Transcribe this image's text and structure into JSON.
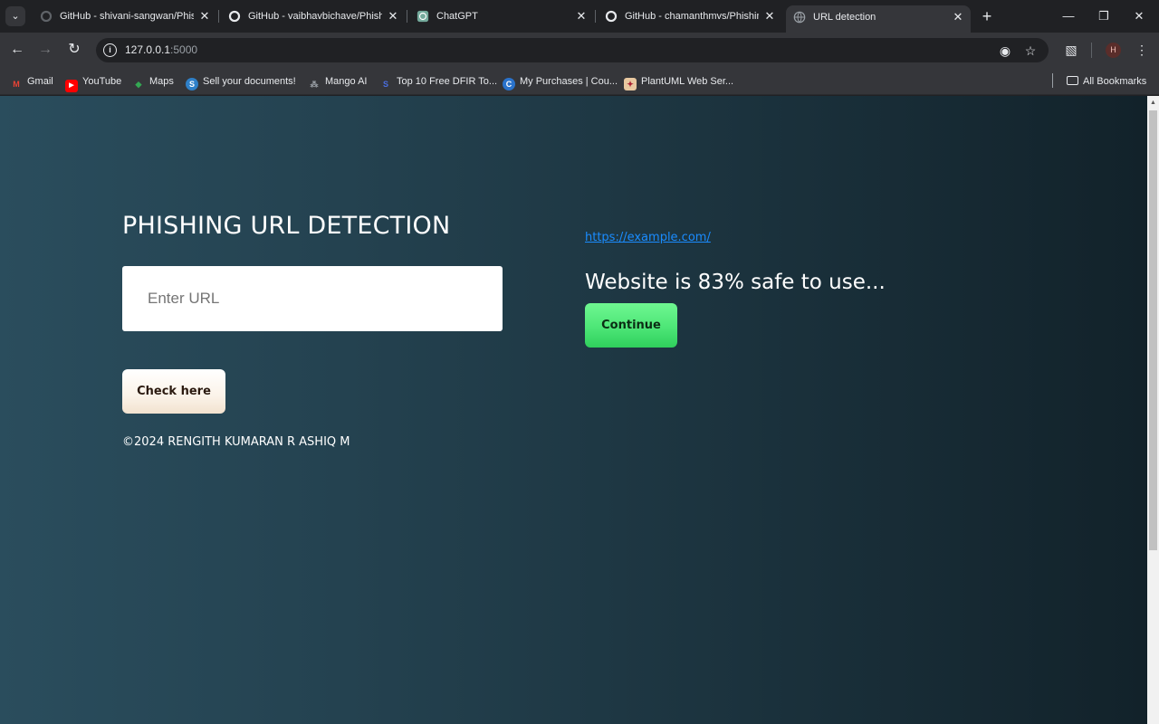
{
  "browser": {
    "tabs": [
      {
        "title": "GitHub - shivani-sangwan/Phish",
        "favicon": "github-icon",
        "active": false
      },
      {
        "title": "GitHub - vaibhavbichave/Phish",
        "favicon": "github-icon",
        "active": false
      },
      {
        "title": "ChatGPT",
        "favicon": "chatgpt-icon",
        "active": false
      },
      {
        "title": "GitHub - chamanthmvs/Phishin",
        "favicon": "github-icon",
        "active": false
      },
      {
        "title": "URL detection",
        "favicon": "globe-icon",
        "active": true
      }
    ],
    "address": {
      "host": "127.0.0.1",
      "port": ":5000"
    },
    "profile_initial": "H",
    "bookmarks": [
      {
        "label": "Gmail",
        "icon": "gmail-icon"
      },
      {
        "label": "YouTube",
        "icon": "youtube-icon"
      },
      {
        "label": "Maps",
        "icon": "maps-icon"
      },
      {
        "label": "Sell your documents!",
        "icon": "docs-icon"
      },
      {
        "label": "Mango AI",
        "icon": "mango-icon"
      },
      {
        "label": "Top 10 Free DFIR To...",
        "icon": "dfir-icon"
      },
      {
        "label": "My Purchases | Cou...",
        "icon": "coursera-icon"
      },
      {
        "label": "PlantUML Web Ser...",
        "icon": "plantuml-icon"
      }
    ],
    "all_bookmarks_label": "All Bookmarks"
  },
  "page": {
    "heading": "PHISHING URL DETECTION",
    "input_placeholder": "Enter URL",
    "check_button": "Check here",
    "footer": "©2024 RENGITH KUMARAN R ASHIQ M",
    "result": {
      "url": "https://example.com/",
      "message": "Website is 83% safe to use...",
      "continue_button": "Continue"
    }
  },
  "colors": {
    "link": "#1a8cff",
    "continue": "#4de677",
    "background_left": "#2a4d5d",
    "background_right": "#12222a"
  }
}
